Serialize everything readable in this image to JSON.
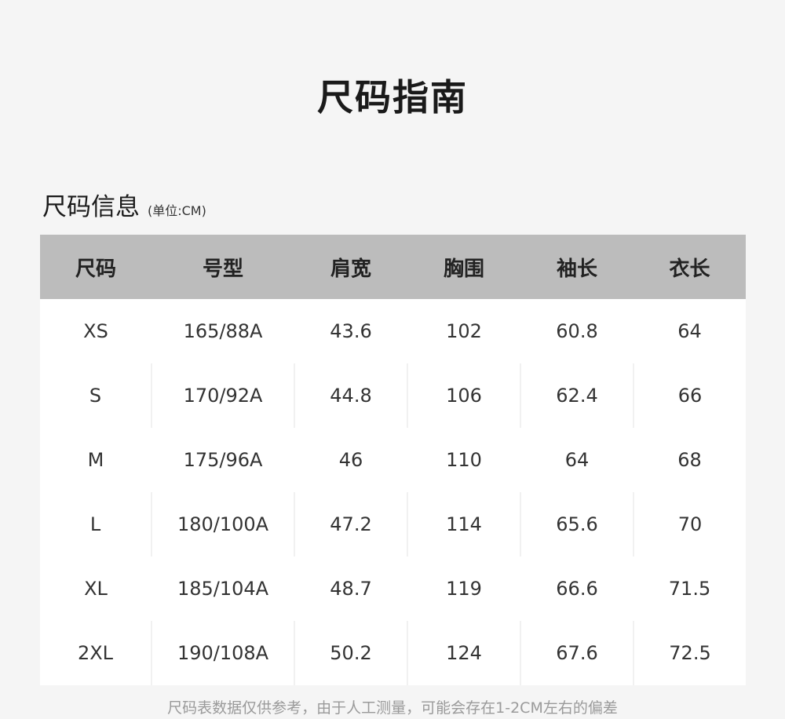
{
  "page": {
    "title": "尺码指南"
  },
  "section": {
    "title": "尺码信息",
    "unit": "(单位:CM)"
  },
  "table": {
    "headers": [
      "尺码",
      "号型",
      "肩宽",
      "胸围",
      "袖长",
      "衣长"
    ],
    "rows": [
      [
        "XS",
        "165/88A",
        "43.6",
        "102",
        "60.8",
        "64"
      ],
      [
        "S",
        "170/92A",
        "44.8",
        "106",
        "62.4",
        "66"
      ],
      [
        "M",
        "175/96A",
        "46",
        "110",
        "64",
        "68"
      ],
      [
        "L",
        "180/100A",
        "47.2",
        "114",
        "65.6",
        "70"
      ],
      [
        "XL",
        "185/104A",
        "48.7",
        "119",
        "66.6",
        "71.5"
      ],
      [
        "2XL",
        "190/108A",
        "50.2",
        "124",
        "67.6",
        "72.5"
      ]
    ]
  },
  "footnote": "尺码表数据仅供参考，由于人工测量，可能会存在1-2CM左右的偏差",
  "colors": {
    "background": "#f5f5f5",
    "header_background": "#bcbcbc",
    "row_background": "#ffffff",
    "footnote_text": "#9a9a9a"
  }
}
